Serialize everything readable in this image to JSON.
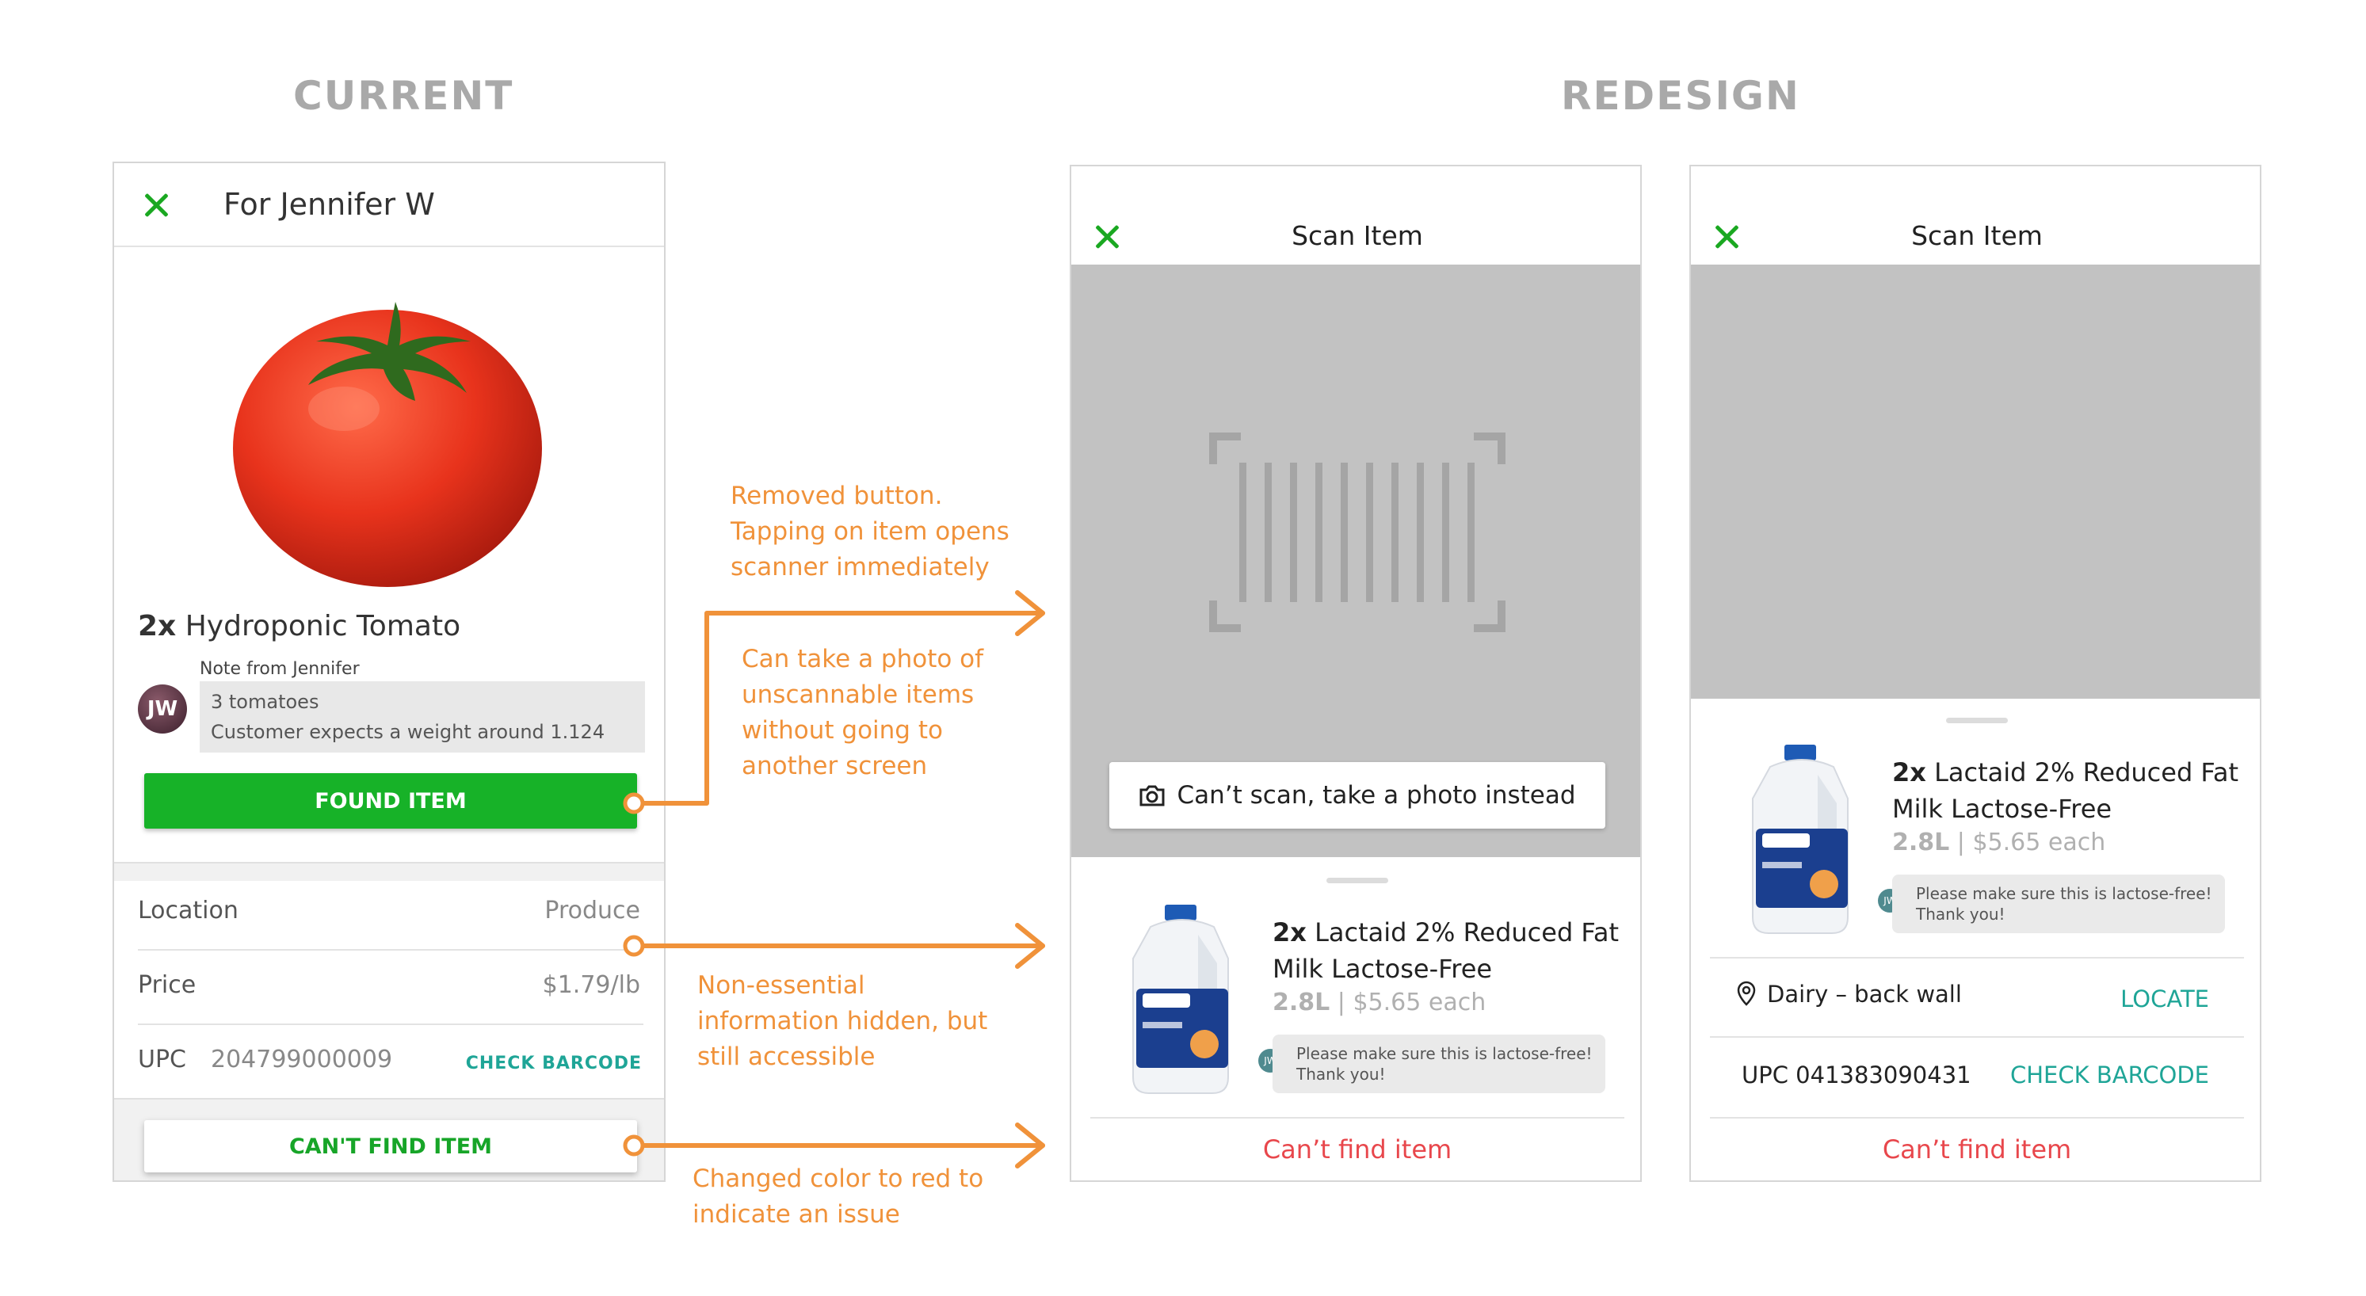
{
  "headings": {
    "current": "CURRENT",
    "redesign": "REDESIGN"
  },
  "current": {
    "title": "For Jennifer W",
    "product_qty": "2x",
    "product_name": "Hydroponic Tomato",
    "note_label": "Note from Jennifer",
    "avatar_initials": "JW",
    "note_line1": "3 tomatoes",
    "note_line2": "Customer expects a weight around 1.124",
    "found_button": "FOUND ITEM",
    "location_label": "Location",
    "location_value": "Produce",
    "price_label": "Price",
    "price_value": "$1.79/lb",
    "upc_label": "UPC",
    "upc_value": "204799000009",
    "check_barcode": "CHECK BARCODE",
    "cant_find_button": "CAN'T FIND ITEM"
  },
  "redesign1": {
    "title": "Scan Item",
    "photo_button": "Can’t scan, take a photo instead",
    "product_qty": "2x",
    "product_name_line1": "Lactaid 2% Reduced Fat",
    "product_name_line2": "Milk Lactose-Free",
    "size": "2.8L",
    "price": "$5.65 each",
    "avatar_initials": "JW",
    "note_line1": "Please make sure this is lactose-free!",
    "note_line2": "Thank you!",
    "cant_find": "Can’t find item"
  },
  "redesign2": {
    "title": "Scan Item",
    "product_qty": "2x",
    "product_name_line1": "Lactaid 2% Reduced Fat",
    "product_name_line2": "Milk Lactose-Free",
    "size": "2.8L",
    "price": "$5.65 each",
    "avatar_initials": "JW",
    "note_line1": "Please make sure this is lactose-free!",
    "note_line2": "Thank you!",
    "location": "Dairy – back wall",
    "locate_button": "LOCATE",
    "upc": "UPC 041383090431",
    "check_barcode": "CHECK BARCODE",
    "cant_find": "Can’t find item"
  },
  "annotations": {
    "a1": "Removed button.\nTapping on item opens\nscanner immediately",
    "a2": "Can take a photo of\nunscannable items\nwithout going to\nanother screen",
    "a3": "Non-essential\ninformation hidden, but\nstill accessible",
    "a4": "Changed color to red to\nindicate an issue"
  },
  "colors": {
    "green": "#17b228",
    "orange": "#f0923a",
    "teal": "#1fa597",
    "red": "#e8474c"
  }
}
